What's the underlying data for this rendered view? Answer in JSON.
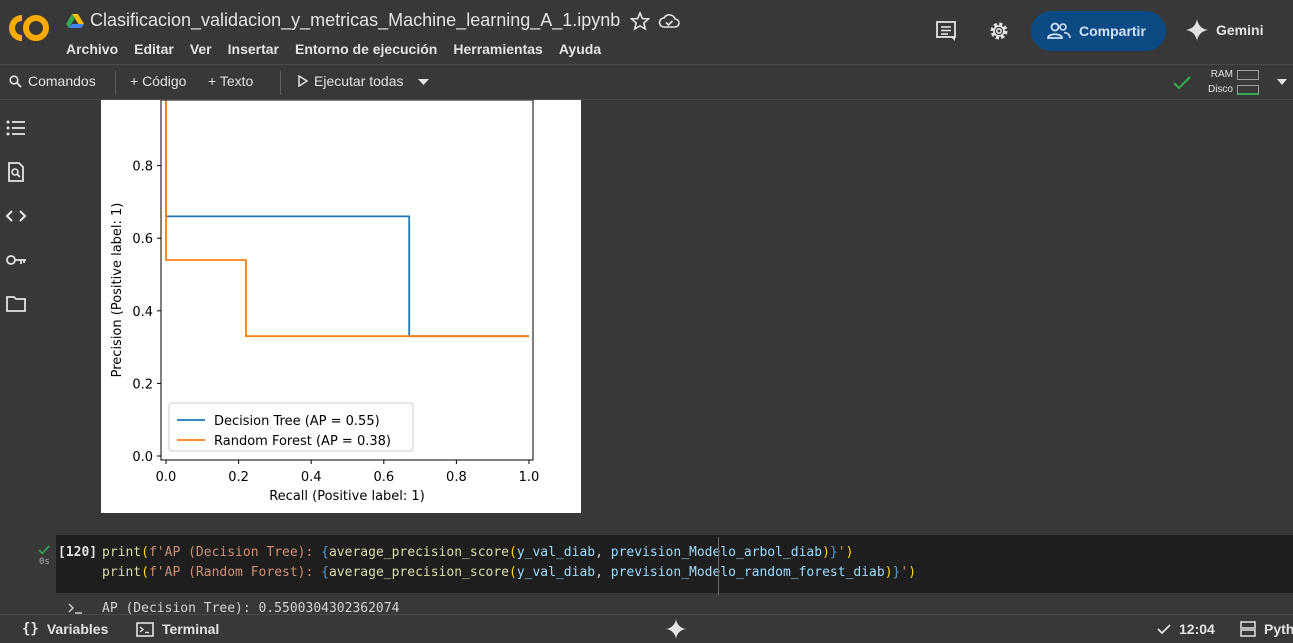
{
  "header": {
    "notebook_title": "Clasificacion_validacion_y_metricas_Machine_learning_A_1.ipynb",
    "menu": [
      "Archivo",
      "Editar",
      "Ver",
      "Insertar",
      "Entorno de ejecución",
      "Herramientas",
      "Ayuda"
    ],
    "share_label": "Compartir",
    "gemini_label": "Gemini",
    "colab_accent": "#f9ab00"
  },
  "toolbar": {
    "commands_label": "Comandos",
    "code_label": "+ Código",
    "text_label": "+ Texto",
    "run_all_label": "Ejecutar todas",
    "ram_label": "RAM",
    "disk_label": "Disco"
  },
  "chart_data": {
    "type": "line",
    "xlabel": "Recall (Positive label: 1)",
    "ylabel": "Precision (Positive label: 1)",
    "xlim": [
      0.0,
      1.0
    ],
    "ylim": [
      0.0,
      1.0
    ],
    "x_ticks": [
      "0.0",
      "0.2",
      "0.4",
      "0.6",
      "0.8",
      "1.0"
    ],
    "y_ticks": [
      "0.0",
      "0.2",
      "0.4",
      "0.6",
      "0.8"
    ],
    "legend_position": "lower-left",
    "grid": false,
    "series": [
      {
        "name": "Decision Tree (AP = 0.55)",
        "color": "#1f77b4",
        "x": [
          0.0,
          0.0,
          0.67,
          0.67,
          1.0
        ],
        "y": [
          1.0,
          0.66,
          0.66,
          0.33,
          0.33
        ]
      },
      {
        "name": "Random Forest (AP = 0.38)",
        "color": "#ff7f0e",
        "x": [
          0.0,
          0.0,
          0.22,
          0.22,
          1.0
        ],
        "y": [
          1.0,
          0.54,
          0.54,
          0.33,
          0.33
        ]
      }
    ]
  },
  "cell": {
    "exec_count": "[120]",
    "run_time": "0s",
    "line1": {
      "a": "print",
      "b": "(",
      "c": "f'AP (Decision Tree): ",
      "d": "{",
      "e": "average_precision_score",
      "f": "(",
      "g": "y_val_diab",
      "h": ", ",
      "i": "prevision_Modelo_arbol_diab",
      "j": ")",
      "k": "}",
      "l": "'",
      "m": ")"
    },
    "line2": {
      "a": "print",
      "b": "(",
      "c": "f'AP (Random Forest): ",
      "d": "{",
      "e": "average_precision_score",
      "f": "(",
      "g": "y_val_diab",
      "h": ", ",
      "i": "prevision_Modelo_random_forest_diab",
      "j": ")",
      "k": "}",
      "l": "'",
      "m": ")"
    },
    "output_partial": "AP (Decision Tree): 0.5500304302362074"
  },
  "status": {
    "variables_label": "Variables",
    "terminal_label": "Terminal",
    "time": "12:04",
    "runtime_label": "Pyth"
  }
}
